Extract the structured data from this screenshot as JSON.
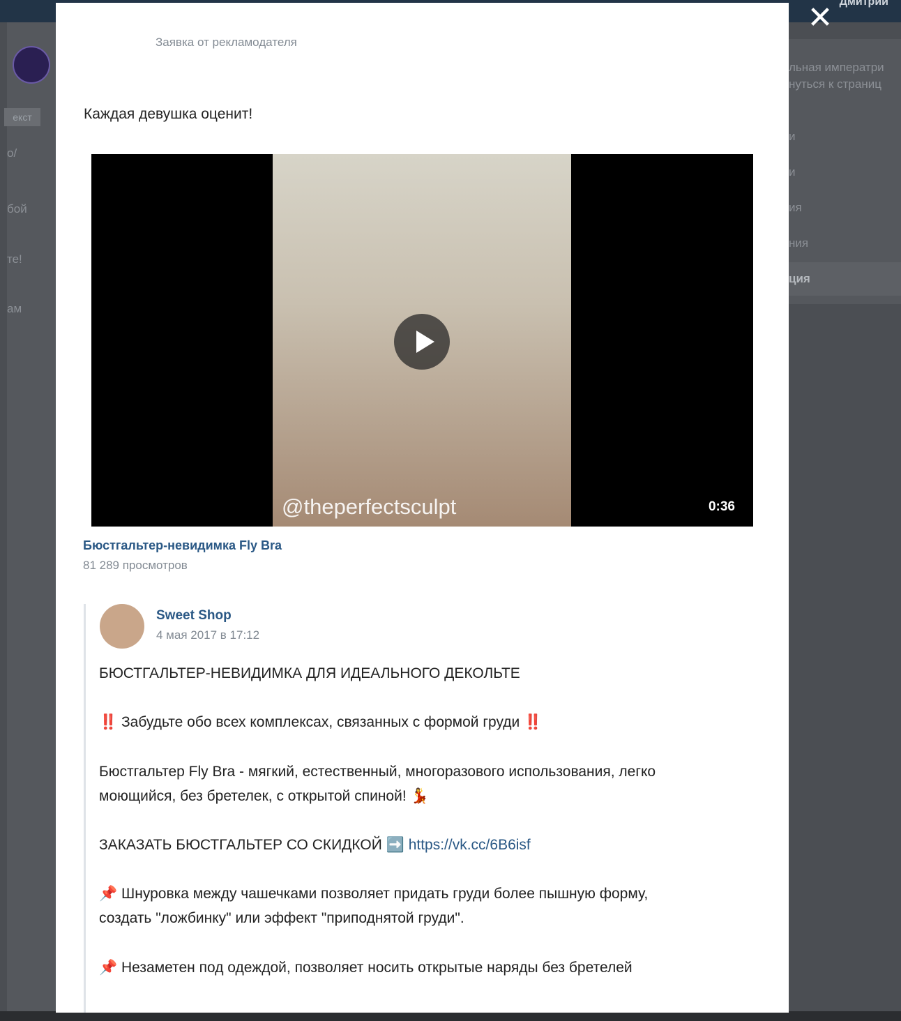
{
  "background": {
    "topbar_user": "Дмитрий",
    "left_button": "екст",
    "left_lines": [
      "о/",
      "бой",
      "те!",
      "ам"
    ],
    "right_lines": [
      "льная императри",
      "нуться к страниц",
      "и",
      "и",
      "ия",
      "ния",
      "ция"
    ]
  },
  "modal": {
    "close": "✕",
    "ad_label": "Заявка от рекламодателя",
    "post_text": "Каждая девушка оценит!",
    "video": {
      "watermark": "@theperfectsculpt",
      "duration": "0:36",
      "title": "Бюстгальтер-невидимка Fly Bra",
      "views": "81 289 просмотров"
    },
    "repost": {
      "author": "Sweet Shop",
      "date": "4 мая 2017 в 17:12",
      "headline": "БЮСТГАЛЬТЕР-НЕВИДИМКА ДЛЯ ИДЕАЛЬНОГО ДЕКОЛЬТЕ",
      "line1_icon": "‼️",
      "line1": "Забудьте обо всех комплексах, связанных с формой груди",
      "line2": "Бюстгальтер Fly Bra - мягкий, естественный, многоразового использования, легко",
      "line3": "моющийся, без бретелек, с открытой спиной!",
      "line3_icon": "💃",
      "order_text": "ЗАКАЗАТЬ БЮСТГАЛЬТЕР СО СКИДКОЙ",
      "order_arrow": "➡️",
      "order_link": "https://vk.cc/6B6isf",
      "pin_icon": "📌",
      "line4": "Шнуровка между чашечками позволяет придать груди более пышную форму,",
      "line5": "создать \"ложбинку\" или эффект \"приподнятой груди\".",
      "line6": "Незаметен под одеждой, позволяет носить открытые наряды без бретелей"
    }
  }
}
